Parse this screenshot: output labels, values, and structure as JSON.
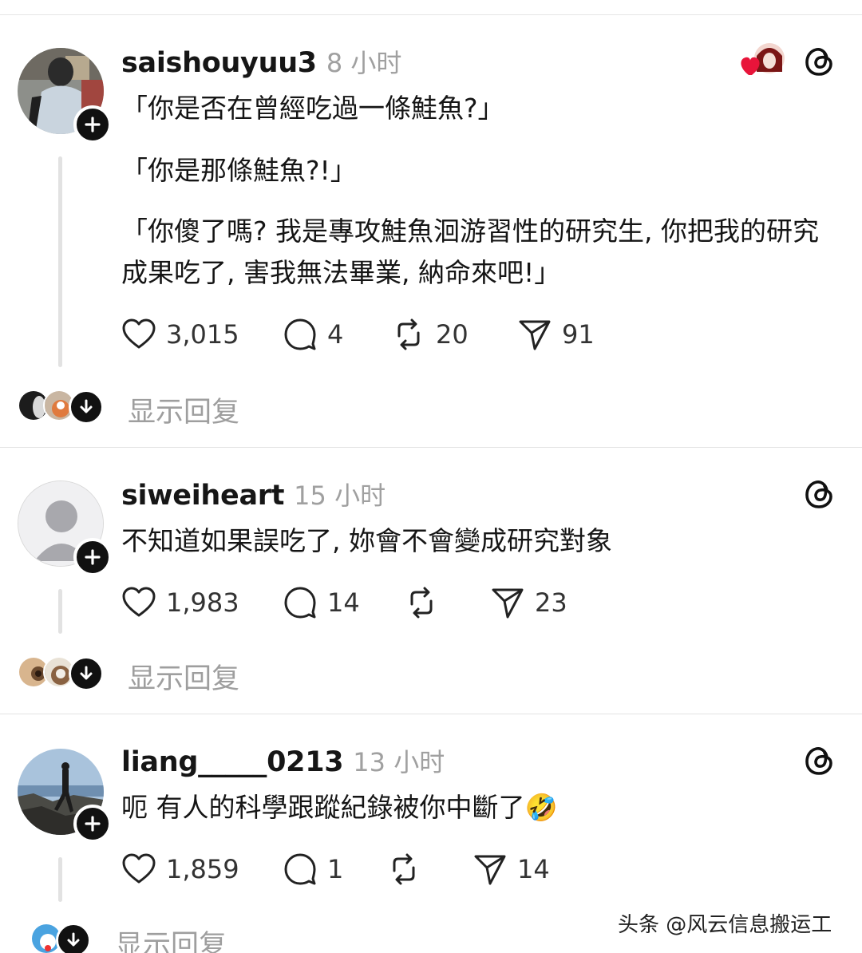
{
  "posts": [
    {
      "username": "saishouyuu3",
      "time": "8 小时",
      "paragraphs": [
        "「你是否在曾經吃過一條鮭魚?」",
        "「你是那條鮭魚?!」",
        "「你傻了嗎? 我是專攻鮭魚洄游習性的研究生, 你把我的研究成果吃了, 害我無法畢業, 納命來吧!」"
      ],
      "likes": "3,015",
      "comments": "4",
      "reposts": "20",
      "shares": "91",
      "show_replies": "显示回复"
    },
    {
      "username": "siweiheart",
      "time": "15 小时",
      "paragraphs": [
        "不知道如果誤吃了, 妳會不會變成研究對象"
      ],
      "likes": "1,983",
      "comments": "14",
      "reposts": "",
      "shares": "23",
      "show_replies": "显示回复"
    },
    {
      "username": "liang_____0213",
      "time": "13 小时",
      "paragraphs": [
        "呃 有人的科學跟蹤紀錄被你中斷了🤣"
      ],
      "likes": "1,859",
      "comments": "1",
      "reposts": "",
      "shares": "14",
      "show_replies": "显示回复"
    }
  ],
  "watermark": "头条 @风云信息搬运工",
  "icons": [
    "plus-icon",
    "threads-logo-icon",
    "heart-icon",
    "comment-icon",
    "repost-icon",
    "share-icon",
    "arrow-down-icon"
  ],
  "colors": {
    "text": "#151515",
    "muted": "#9e9e9e",
    "badge": "#111111",
    "like_heart": "#e8143a"
  }
}
